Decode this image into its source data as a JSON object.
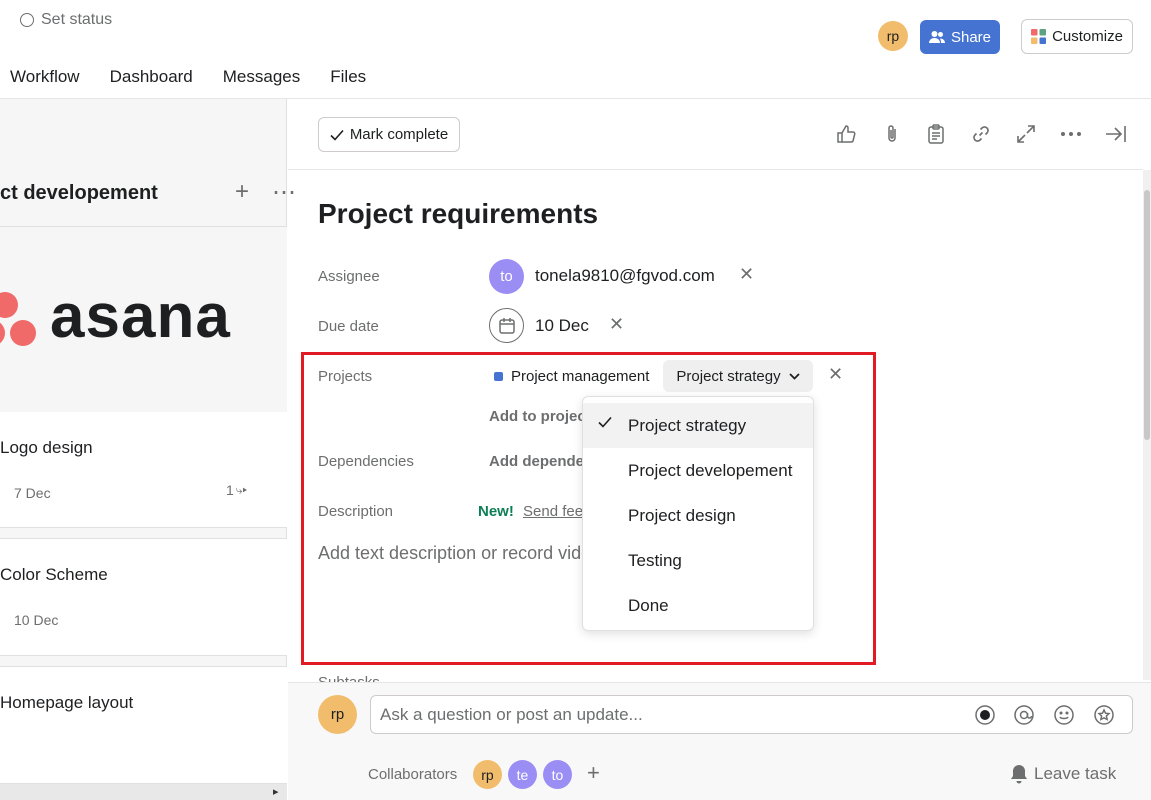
{
  "header": {
    "set_status": "Set status",
    "user_initials": "rp",
    "share_label": "Share",
    "customize_label": "Customize",
    "tabs": [
      "Workflow",
      "Dashboard",
      "Messages",
      "Files"
    ]
  },
  "board": {
    "column_title": "ct developement",
    "logo_text": "asana",
    "cards": [
      {
        "title": "Logo design",
        "date": "7 Dec",
        "subtasks": "1"
      },
      {
        "title": "Color Scheme",
        "date": "10 Dec"
      },
      {
        "title": "Homepage layout"
      }
    ]
  },
  "task": {
    "mark_complete_label": "Mark complete",
    "title": "Project requirements",
    "assignee_label": "Assignee",
    "assignee_initials": "to",
    "assignee_email": "tonela9810@fgvod.com",
    "due_label": "Due date",
    "due_value": "10 Dec",
    "projects_label": "Projects",
    "project_name": "Project management",
    "section_selected": "Project strategy",
    "add_to_project": "Add to projec",
    "dependencies_label": "Dependencies",
    "add_dependency": "Add depende",
    "description_label": "Description",
    "new_badge": "New!",
    "send_feedback": "Send fee",
    "description_placeholder": "Add text description or record vide",
    "subtasks_label": "Subtasks"
  },
  "dropdown": {
    "options": [
      "Project strategy",
      "Project developement",
      "Project design",
      "Testing",
      "Done"
    ],
    "selected_index": 0
  },
  "comment": {
    "user_initials": "rp",
    "placeholder": "Ask a question or post an update...",
    "collaborators_label": "Collaborators",
    "collaborators": [
      "rp",
      "te",
      "to"
    ],
    "leave_task": "Leave task"
  },
  "colors": {
    "accent": "#4573d2",
    "highlight_border": "#e21a23",
    "new_badge": "#0d7f56",
    "asana_coral": "#f06a6a"
  }
}
